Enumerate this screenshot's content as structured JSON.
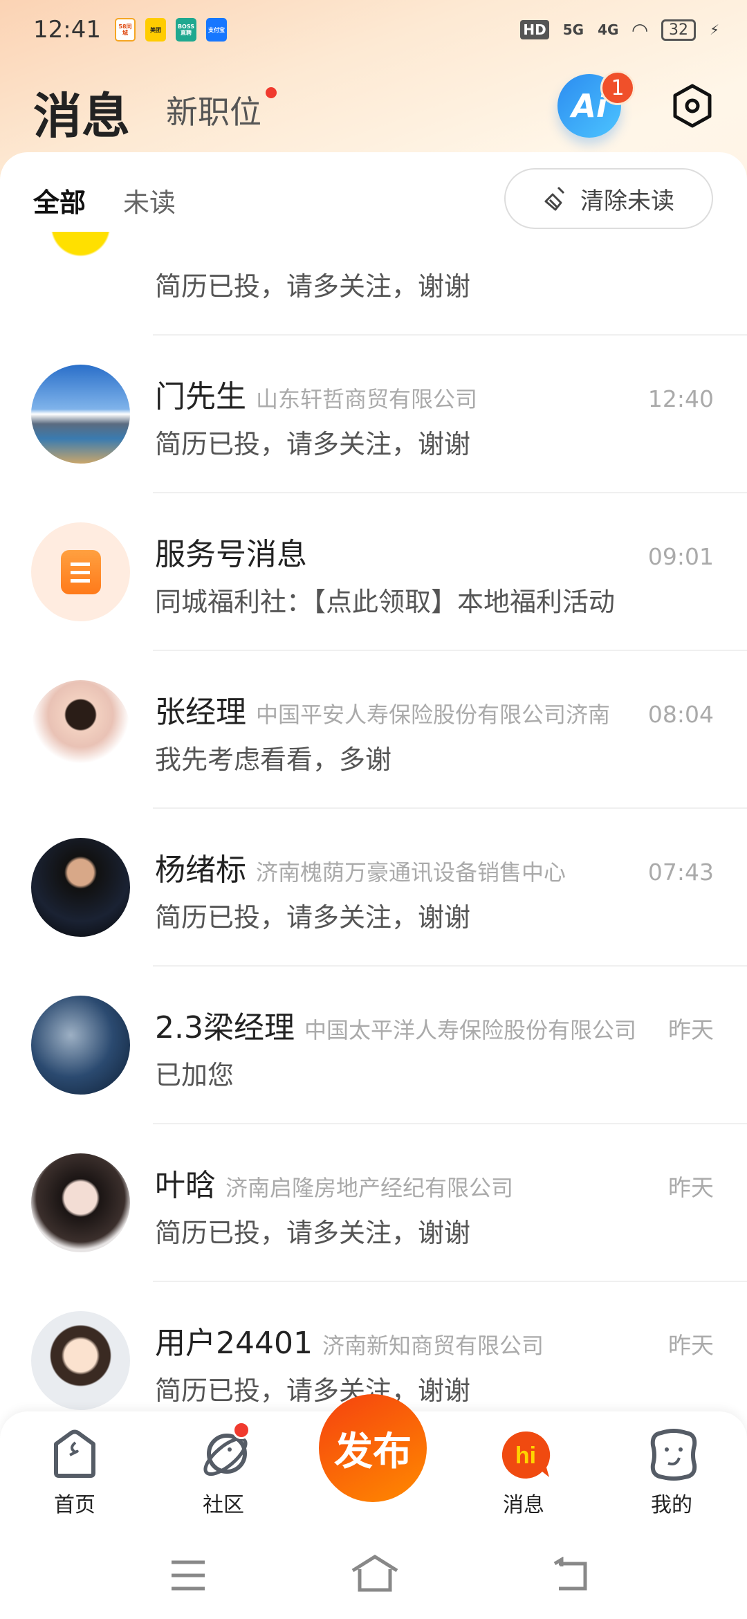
{
  "status_bar": {
    "time": "12:41",
    "apps": [
      "58同城",
      "美团",
      "BOSS直聘",
      "支付宝"
    ],
    "signal1": "5G",
    "signal2": "4G",
    "hd": "HD",
    "battery": "32"
  },
  "header": {
    "title": "消息",
    "new_jobs": "新职位",
    "ai_label": "Ai",
    "ai_badge": "1"
  },
  "filters": {
    "all": "全部",
    "unread": "未读",
    "clear_unread": "清除未读"
  },
  "conversations": [
    {
      "name": "",
      "company": "",
      "time": "",
      "message": "简历已投，请多关注，谢谢",
      "avatar": "smiley-logo"
    },
    {
      "name": "门先生",
      "company": "山东轩哲商贸有限公司",
      "time": "12:40",
      "message": "简历已投，请多关注，谢谢",
      "avatar": "landscape"
    },
    {
      "name": "服务号消息",
      "company": "",
      "time": "09:01",
      "message": "同城福利社：【点此领取】本地福利活动",
      "avatar": "service-icon"
    },
    {
      "name": "张经理",
      "company": "中国平安人寿保险股份有限公司济南",
      "time": "08:04",
      "message": "我先考虑看看，多谢",
      "avatar": "woman-photo"
    },
    {
      "name": "杨绪标",
      "company": "济南槐荫万豪通讯设备销售中心",
      "time": "07:43",
      "message": "简历已投，请多关注，谢谢",
      "avatar": "man-photo"
    },
    {
      "name": "2.3梁经理",
      "company": "中国太平洋人寿保险股份有限公司",
      "time": "昨天",
      "message": "已加您",
      "avatar": "coral"
    },
    {
      "name": "叶晗",
      "company": "济南启隆房地产经纪有限公司",
      "time": "昨天",
      "message": "简历已投，请多关注，谢谢",
      "avatar": "illustrated-woman"
    },
    {
      "name": "用户24401",
      "company": "济南新知商贸有限公司",
      "time": "昨天",
      "message": "简历已投，请多关注，谢谢",
      "avatar": "cartoon-woman"
    }
  ],
  "bottom_nav": {
    "home": "首页",
    "community": "社区",
    "publish": "发布",
    "messages": "消息",
    "messages_icon_text": "hi",
    "mine": "我的"
  },
  "colors": {
    "accent": "#ff5a12",
    "badge": "#f03a2e",
    "ai": "#2c8cf0"
  }
}
